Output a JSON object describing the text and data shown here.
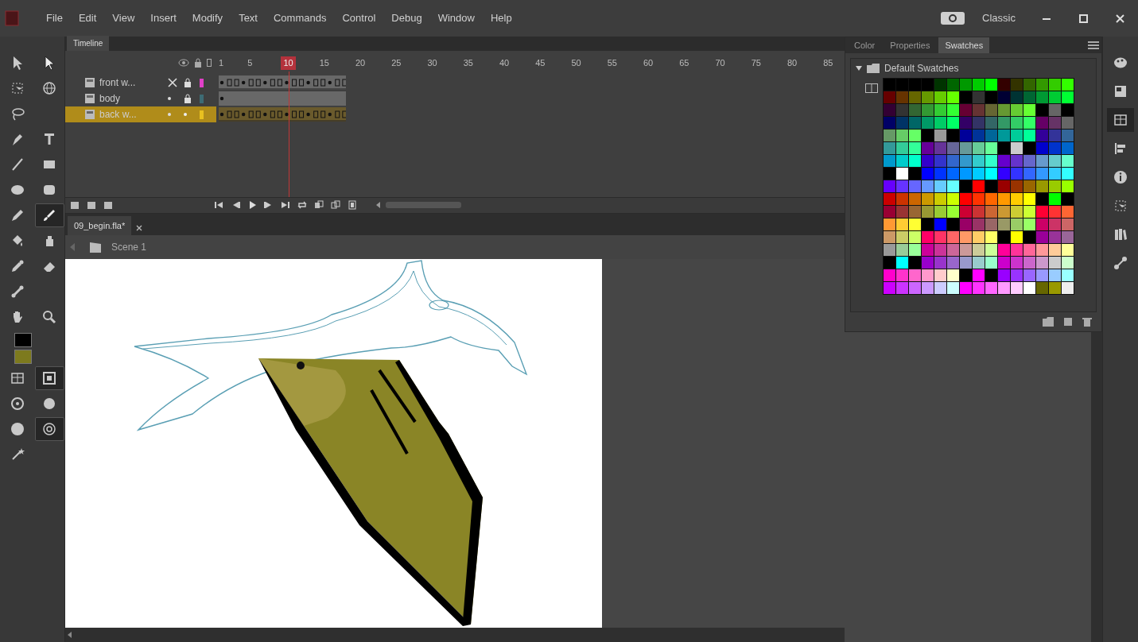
{
  "menu": [
    "File",
    "Edit",
    "View",
    "Insert",
    "Modify",
    "Text",
    "Commands",
    "Control",
    "Debug",
    "Window",
    "Help"
  ],
  "workspace": {
    "label": "Classic"
  },
  "tool_rows": [
    {
      "tools": [
        {
          "kind": "arrow",
          "selected": false
        },
        {
          "kind": "hollow-arrow",
          "selected": false
        }
      ]
    },
    {
      "tools": [
        {
          "kind": "transform",
          "selected": false
        },
        {
          "kind": "globe",
          "selected": false
        }
      ]
    },
    {
      "tools": [
        {
          "kind": "lasso",
          "selected": false
        }
      ]
    },
    {
      "tools": [
        {
          "kind": "pen",
          "selected": false
        },
        {
          "kind": "text",
          "selected": false
        }
      ]
    },
    {
      "tools": [
        {
          "kind": "line",
          "selected": false
        },
        {
          "kind": "rectangle",
          "selected": false
        }
      ]
    },
    {
      "tools": [
        {
          "kind": "oval",
          "selected": false
        },
        {
          "kind": "rounded-rectangle",
          "selected": false
        }
      ]
    },
    {
      "tools": [
        {
          "kind": "pencil",
          "selected": false
        },
        {
          "kind": "brush",
          "selected": true
        }
      ]
    },
    {
      "tools": [
        {
          "kind": "bucket",
          "selected": false
        },
        {
          "kind": "ink-bottle",
          "selected": false
        }
      ]
    },
    {
      "tools": [
        {
          "kind": "dropper",
          "selected": false
        },
        {
          "kind": "eraser",
          "selected": false
        }
      ]
    },
    {
      "tools": [
        {
          "kind": "bone",
          "selected": false
        }
      ]
    },
    {
      "tools": [
        {
          "kind": "hand",
          "selected": false
        },
        {
          "kind": "magnifier",
          "selected": false
        }
      ]
    }
  ],
  "stroke": {
    "color": "#000000"
  },
  "fill": {
    "color": "#7d7a1e"
  },
  "option_rows": [
    {
      "tools": [
        {
          "kind": "grid",
          "selected": false
        },
        {
          "kind": "square-ring",
          "selected": true
        }
      ]
    },
    {
      "tools": [
        {
          "kind": "sphere",
          "selected": false
        },
        {
          "kind": "dot",
          "selected": false
        }
      ]
    },
    {
      "tools": [
        {
          "kind": "disc",
          "selected": false
        },
        {
          "kind": "target",
          "selected": true
        }
      ]
    },
    {
      "tools": [
        {
          "kind": "wand",
          "selected": false
        }
      ]
    }
  ],
  "timeline": {
    "tab": "Timeline",
    "ruler": [
      {
        "label": "1",
        "selected": false
      },
      {
        "label": "5",
        "selected": false
      },
      {
        "label": "10",
        "selected": true
      },
      {
        "label": "15",
        "selected": false
      },
      {
        "label": "20",
        "selected": false
      },
      {
        "label": "25",
        "selected": false
      },
      {
        "label": "30",
        "selected": false
      },
      {
        "label": "35",
        "selected": false
      },
      {
        "label": "40",
        "selected": false
      },
      {
        "label": "45",
        "selected": false
      },
      {
        "label": "50",
        "selected": false
      },
      {
        "label": "55",
        "selected": false
      },
      {
        "label": "60",
        "selected": false
      },
      {
        "label": "65",
        "selected": false
      },
      {
        "label": "70",
        "selected": false
      },
      {
        "label": "75",
        "selected": false
      },
      {
        "label": "80",
        "selected": false
      },
      {
        "label": "85",
        "selected": false
      }
    ],
    "layers": [
      {
        "name": "front w...",
        "hidden": true,
        "locked": true,
        "selected": false,
        "color": "#e040c8",
        "kind": "animated"
      },
      {
        "name": "body",
        "hidden": false,
        "locked": true,
        "selected": false,
        "color": "#3d6b74",
        "kind": "single"
      },
      {
        "name": "back w...",
        "hidden": false,
        "locked": false,
        "selected": true,
        "color": "#e8c020",
        "kind": "animated"
      }
    ]
  },
  "document": {
    "tab": "09_begin.fla*",
    "scene": "Scene 1"
  },
  "panel": {
    "tabs": [
      {
        "label": "Color",
        "selected": false
      },
      {
        "label": "Properties",
        "selected": false
      },
      {
        "label": "Swatches",
        "selected": true
      }
    ],
    "folder": "Default Swatches"
  },
  "swatches": [
    {
      "cells": [
        {
          "color": "#000000"
        },
        {
          "color": "#000000"
        },
        {
          "color": "#000000"
        },
        {
          "color": "#000000"
        },
        {
          "color": "#003300"
        },
        {
          "color": "#006600"
        },
        {
          "color": "#009900"
        },
        {
          "color": "#00cc00"
        },
        {
          "color": "#00ff00"
        },
        {
          "color": "#330000"
        },
        {
          "color": "#333300"
        },
        {
          "color": "#336600"
        },
        {
          "color": "#339900"
        },
        {
          "color": "#33cc00"
        },
        {
          "color": "#33ff00"
        }
      ]
    },
    {
      "cells": [
        {
          "color": "#660000"
        },
        {
          "color": "#663300"
        },
        {
          "color": "#666600"
        },
        {
          "color": "#669900"
        },
        {
          "color": "#66cc00"
        },
        {
          "color": "#66ff00"
        },
        {
          "color": "#000000"
        },
        {
          "color": "#333333"
        },
        {
          "color": "#000000"
        },
        {
          "color": "#000033"
        },
        {
          "color": "#003333"
        },
        {
          "color": "#006633"
        },
        {
          "color": "#009933"
        },
        {
          "color": "#00cc33"
        },
        {
          "color": "#00ff33"
        }
      ]
    },
    {
      "cells": [
        {
          "color": "#330033"
        },
        {
          "color": "#333333"
        },
        {
          "color": "#336633"
        },
        {
          "color": "#339933"
        },
        {
          "color": "#33cc33"
        },
        {
          "color": "#33ff33"
        },
        {
          "color": "#660033"
        },
        {
          "color": "#663333"
        },
        {
          "color": "#666633"
        },
        {
          "color": "#669933"
        },
        {
          "color": "#66cc33"
        },
        {
          "color": "#66ff33"
        },
        {
          "color": "#000000"
        },
        {
          "color": "#666666"
        },
        {
          "color": "#000000"
        }
      ]
    },
    {
      "cells": [
        {
          "color": "#000066"
        },
        {
          "color": "#003366"
        },
        {
          "color": "#006666"
        },
        {
          "color": "#009966"
        },
        {
          "color": "#00cc66"
        },
        {
          "color": "#00ff66"
        },
        {
          "color": "#330066"
        },
        {
          "color": "#333366"
        },
        {
          "color": "#336666"
        },
        {
          "color": "#339966"
        },
        {
          "color": "#33cc66"
        },
        {
          "color": "#33ff66"
        },
        {
          "color": "#660066"
        },
        {
          "color": "#663366"
        },
        {
          "color": "#666666"
        }
      ]
    },
    {
      "cells": [
        {
          "color": "#669966"
        },
        {
          "color": "#66cc66"
        },
        {
          "color": "#66ff66"
        },
        {
          "color": "#000000"
        },
        {
          "color": "#999999"
        },
        {
          "color": "#000000"
        },
        {
          "color": "#000099"
        },
        {
          "color": "#003399"
        },
        {
          "color": "#006699"
        },
        {
          "color": "#009999"
        },
        {
          "color": "#00cc99"
        },
        {
          "color": "#00ff99"
        },
        {
          "color": "#330099"
        },
        {
          "color": "#333399"
        },
        {
          "color": "#336699"
        }
      ]
    },
    {
      "cells": [
        {
          "color": "#339999"
        },
        {
          "color": "#33cc99"
        },
        {
          "color": "#33ff99"
        },
        {
          "color": "#660099"
        },
        {
          "color": "#663399"
        },
        {
          "color": "#666699"
        },
        {
          "color": "#669999"
        },
        {
          "color": "#66cc99"
        },
        {
          "color": "#66ff99"
        },
        {
          "color": "#000000"
        },
        {
          "color": "#cccccc"
        },
        {
          "color": "#000000"
        },
        {
          "color": "#0000cc"
        },
        {
          "color": "#0033cc"
        },
        {
          "color": "#0066cc"
        }
      ]
    },
    {
      "cells": [
        {
          "color": "#0099cc"
        },
        {
          "color": "#00cccc"
        },
        {
          "color": "#00ffcc"
        },
        {
          "color": "#3300cc"
        },
        {
          "color": "#3333cc"
        },
        {
          "color": "#3366cc"
        },
        {
          "color": "#3399cc"
        },
        {
          "color": "#33cccc"
        },
        {
          "color": "#33ffcc"
        },
        {
          "color": "#6600cc"
        },
        {
          "color": "#6633cc"
        },
        {
          "color": "#6666cc"
        },
        {
          "color": "#6699cc"
        },
        {
          "color": "#66cccc"
        },
        {
          "color": "#66ffcc"
        }
      ]
    },
    {
      "cells": [
        {
          "color": "#000000"
        },
        {
          "color": "#ffffff"
        },
        {
          "color": "#000000"
        },
        {
          "color": "#0000ff"
        },
        {
          "color": "#0033ff"
        },
        {
          "color": "#0066ff"
        },
        {
          "color": "#0099ff"
        },
        {
          "color": "#00ccff"
        },
        {
          "color": "#00ffff"
        },
        {
          "color": "#3300ff"
        },
        {
          "color": "#3333ff"
        },
        {
          "color": "#3366ff"
        },
        {
          "color": "#3399ff"
        },
        {
          "color": "#33ccff"
        },
        {
          "color": "#33ffff"
        }
      ]
    },
    {
      "cells": [
        {
          "color": "#6600ff"
        },
        {
          "color": "#6633ff"
        },
        {
          "color": "#6666ff"
        },
        {
          "color": "#6699ff"
        },
        {
          "color": "#66ccff"
        },
        {
          "color": "#66ffff"
        },
        {
          "color": "#000000"
        },
        {
          "color": "#ff0000"
        },
        {
          "color": "#000000"
        },
        {
          "color": "#990000"
        },
        {
          "color": "#993300"
        },
        {
          "color": "#996600"
        },
        {
          "color": "#999900"
        },
        {
          "color": "#99cc00"
        },
        {
          "color": "#99ff00"
        }
      ]
    },
    {
      "cells": [
        {
          "color": "#cc0000"
        },
        {
          "color": "#cc3300"
        },
        {
          "color": "#cc6600"
        },
        {
          "color": "#cc9900"
        },
        {
          "color": "#cccc00"
        },
        {
          "color": "#ccff00"
        },
        {
          "color": "#ff0000"
        },
        {
          "color": "#ff3300"
        },
        {
          "color": "#ff6600"
        },
        {
          "color": "#ff9900"
        },
        {
          "color": "#ffcc00"
        },
        {
          "color": "#ffff00"
        },
        {
          "color": "#000000"
        },
        {
          "color": "#00ff00"
        },
        {
          "color": "#000000"
        }
      ]
    },
    {
      "cells": [
        {
          "color": "#990033"
        },
        {
          "color": "#993333"
        },
        {
          "color": "#996633"
        },
        {
          "color": "#999933"
        },
        {
          "color": "#99cc33"
        },
        {
          "color": "#99ff33"
        },
        {
          "color": "#cc0033"
        },
        {
          "color": "#cc3333"
        },
        {
          "color": "#cc6633"
        },
        {
          "color": "#cc9933"
        },
        {
          "color": "#cccc33"
        },
        {
          "color": "#ccff33"
        },
        {
          "color": "#ff0033"
        },
        {
          "color": "#ff3333"
        },
        {
          "color": "#ff6633"
        }
      ]
    },
    {
      "cells": [
        {
          "color": "#ff9933"
        },
        {
          "color": "#ffcc33"
        },
        {
          "color": "#ffff33"
        },
        {
          "color": "#000000"
        },
        {
          "color": "#0000ff"
        },
        {
          "color": "#000000"
        },
        {
          "color": "#990066"
        },
        {
          "color": "#993366"
        },
        {
          "color": "#996666"
        },
        {
          "color": "#999966"
        },
        {
          "color": "#99cc66"
        },
        {
          "color": "#99ff66"
        },
        {
          "color": "#cc0066"
        },
        {
          "color": "#cc3366"
        },
        {
          "color": "#cc6666"
        }
      ]
    },
    {
      "cells": [
        {
          "color": "#cc9966"
        },
        {
          "color": "#cccc66"
        },
        {
          "color": "#ccff66"
        },
        {
          "color": "#ff0066"
        },
        {
          "color": "#ff3366"
        },
        {
          "color": "#ff6666"
        },
        {
          "color": "#ff9966"
        },
        {
          "color": "#ffcc66"
        },
        {
          "color": "#ffff66"
        },
        {
          "color": "#000000"
        },
        {
          "color": "#ffff00"
        },
        {
          "color": "#000000"
        },
        {
          "color": "#990099"
        },
        {
          "color": "#993399"
        },
        {
          "color": "#996699"
        }
      ]
    },
    {
      "cells": [
        {
          "color": "#999999"
        },
        {
          "color": "#99cc99"
        },
        {
          "color": "#99ff99"
        },
        {
          "color": "#cc0099"
        },
        {
          "color": "#cc3399"
        },
        {
          "color": "#cc6699"
        },
        {
          "color": "#cc9999"
        },
        {
          "color": "#cccc99"
        },
        {
          "color": "#ccff99"
        },
        {
          "color": "#ff0099"
        },
        {
          "color": "#ff3399"
        },
        {
          "color": "#ff6699"
        },
        {
          "color": "#ff9999"
        },
        {
          "color": "#ffcc99"
        },
        {
          "color": "#ffff99"
        }
      ]
    },
    {
      "cells": [
        {
          "color": "#000000"
        },
        {
          "color": "#00ffff"
        },
        {
          "color": "#000000"
        },
        {
          "color": "#9900cc"
        },
        {
          "color": "#9933cc"
        },
        {
          "color": "#9966cc"
        },
        {
          "color": "#9999cc"
        },
        {
          "color": "#99cccc"
        },
        {
          "color": "#99ffcc"
        },
        {
          "color": "#cc00cc"
        },
        {
          "color": "#cc33cc"
        },
        {
          "color": "#cc66cc"
        },
        {
          "color": "#cc99cc"
        },
        {
          "color": "#cccccc"
        },
        {
          "color": "#ccffcc"
        }
      ]
    },
    {
      "cells": [
        {
          "color": "#ff00cc"
        },
        {
          "color": "#ff33cc"
        },
        {
          "color": "#ff66cc"
        },
        {
          "color": "#ff99cc"
        },
        {
          "color": "#ffcccc"
        },
        {
          "color": "#ffffcc"
        },
        {
          "color": "#000000"
        },
        {
          "color": "#ff00ff"
        },
        {
          "color": "#000000"
        },
        {
          "color": "#9900ff"
        },
        {
          "color": "#9933ff"
        },
        {
          "color": "#9966ff"
        },
        {
          "color": "#9999ff"
        },
        {
          "color": "#99ccff"
        },
        {
          "color": "#99ffff"
        }
      ]
    },
    {
      "cells": [
        {
          "color": "#cc00ff"
        },
        {
          "color": "#cc33ff"
        },
        {
          "color": "#cc66ff"
        },
        {
          "color": "#cc99ff"
        },
        {
          "color": "#ccccff"
        },
        {
          "color": "#ccffff"
        },
        {
          "color": "#ff00ff"
        },
        {
          "color": "#ff33ff"
        },
        {
          "color": "#ff66ff"
        },
        {
          "color": "#ff99ff"
        },
        {
          "color": "#ffccff"
        },
        {
          "color": "#ffffff"
        },
        {
          "color": "#666600"
        },
        {
          "color": "#999900"
        },
        {
          "color": "#eeeeee"
        }
      ]
    }
  ],
  "dock_icons": [
    {
      "kind": "palette",
      "selected": false
    },
    {
      "kind": "panel",
      "selected": false
    },
    {
      "kind": "grid",
      "selected": true
    },
    {
      "kind": "align",
      "selected": false
    },
    {
      "kind": "info",
      "selected": false
    },
    {
      "kind": "transform",
      "selected": false
    },
    {
      "kind": "books",
      "selected": false
    },
    {
      "kind": "nodes",
      "selected": false
    }
  ]
}
